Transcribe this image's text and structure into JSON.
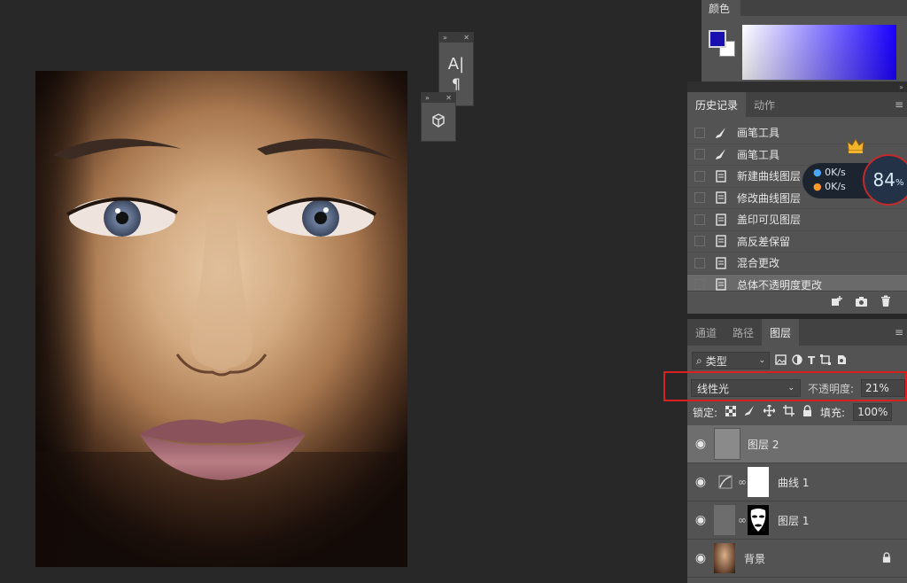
{
  "colors_panel": {
    "title": "颜色"
  },
  "history_panel": {
    "tabs": [
      {
        "label": "历史记录",
        "active": true
      },
      {
        "label": "动作",
        "active": false
      }
    ],
    "items": [
      {
        "label": "画笔工具",
        "icon": "brush-icon"
      },
      {
        "label": "画笔工具",
        "icon": "brush-icon"
      },
      {
        "label": "新建曲线图层",
        "icon": "document-icon"
      },
      {
        "label": "修改曲线图层",
        "icon": "document-icon"
      },
      {
        "label": "盖印可见图层",
        "icon": "document-icon"
      },
      {
        "label": "高反差保留",
        "icon": "document-icon"
      },
      {
        "label": "混合更改",
        "icon": "document-icon"
      },
      {
        "label": "总体不透明度更改",
        "icon": "document-icon",
        "selected": true
      }
    ]
  },
  "layers_panel": {
    "tabs": [
      {
        "label": "通道",
        "active": false
      },
      {
        "label": "路径",
        "active": false
      },
      {
        "label": "图层",
        "active": true
      }
    ],
    "filter_label": "类型",
    "blend_mode": "线性光",
    "opacity_label": "不透明度:",
    "opacity_value": "21%",
    "lock_label": "锁定:",
    "fill_label": "填充:",
    "fill_value": "100%",
    "layers": [
      {
        "name": "图层 2",
        "selected": true
      },
      {
        "name": "曲线 1"
      },
      {
        "name": "图层 1"
      },
      {
        "name": "背景"
      }
    ]
  },
  "speed_widget": {
    "upload": "0K/s",
    "download": "0K/s",
    "percent": "84",
    "percent_unit": "%"
  },
  "mini_panels": {
    "character_glyph": "A|",
    "paragraph_glyph": "¶"
  },
  "accent_colors": {
    "foreground": "#1a10b0",
    "highlight_box": "#d92020"
  }
}
